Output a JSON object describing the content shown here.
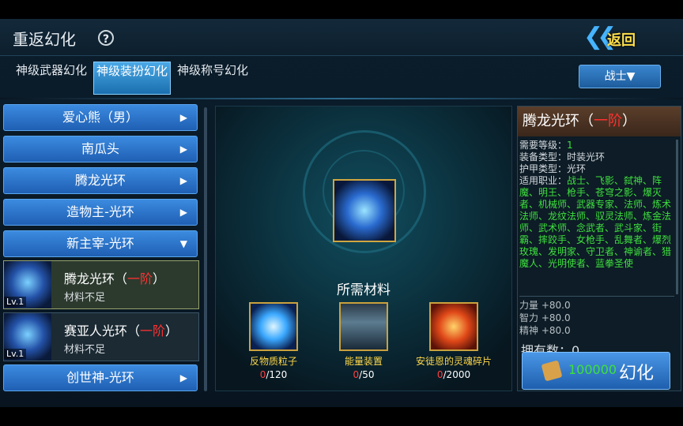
{
  "header": {
    "title": "重返幻化",
    "help_icon": "?",
    "back_label": "返回"
  },
  "tabs": [
    {
      "label": "神级武器幻化",
      "active": false
    },
    {
      "label": "神级装扮幻化",
      "active": true
    },
    {
      "label": "神级称号幻化",
      "active": false
    }
  ],
  "class_select": {
    "label": "战士▼"
  },
  "list": {
    "categories_top": [
      {
        "label": "爱心熊（男）",
        "arrow": "▶"
      },
      {
        "label": "南瓜头",
        "arrow": "▶"
      },
      {
        "label": "腾龙光环",
        "arrow": "▶"
      },
      {
        "label": "造物主-光环",
        "arrow": "▶"
      },
      {
        "label": "新主宰-光环",
        "arrow": "▼"
      }
    ],
    "items": [
      {
        "name": "腾龙光环（",
        "grade": "一阶",
        "close": "）",
        "status": "材料不足",
        "level": "Lv.1"
      },
      {
        "name": "赛亚人光环（",
        "grade": "一阶",
        "close": "）",
        "status": "材料不足",
        "level": "Lv.1"
      }
    ],
    "category_bottom": {
      "label": "创世神-光环",
      "arrow": "▶"
    }
  },
  "center": {
    "needed_label": "所需材料",
    "materials": [
      {
        "name": "反物质粒子",
        "have": "0",
        "need": "/120"
      },
      {
        "name": "能量装置",
        "have": "0",
        "need": "/50"
      },
      {
        "name": "安徒恩的灵魂碎片",
        "have": "0",
        "need": "/2000"
      }
    ]
  },
  "detail": {
    "name": "腾龙光环（",
    "grade": "一阶",
    "close": "）",
    "req_level_label": "需要等级：",
    "req_level": "1",
    "equip_type": "装备类型：时装光环",
    "armor_type": "护甲类型：光环",
    "jobs_label": "适用职业：",
    "jobs": "战士、飞影、弑神、阵魔、明王、枪手、苍穹之影、爆灭者、机械师、武器专家、法师、炼术法师、龙纹法师、驭灵法师、炼金法师、武术师、念武者、武斗家、街霸、摔跤手、女枪手、乱舞者、爆烈玫瑰、发明家、守卫者、神谕者、猎魔人、光明使者、蓝拳圣使",
    "stats": [
      "力量 +80.0",
      "智力 +80.0",
      "精神 +80.0"
    ],
    "own_label": "拥有数：",
    "own_count": "0"
  },
  "convert": {
    "cost": "100000",
    "label": "幻化"
  }
}
